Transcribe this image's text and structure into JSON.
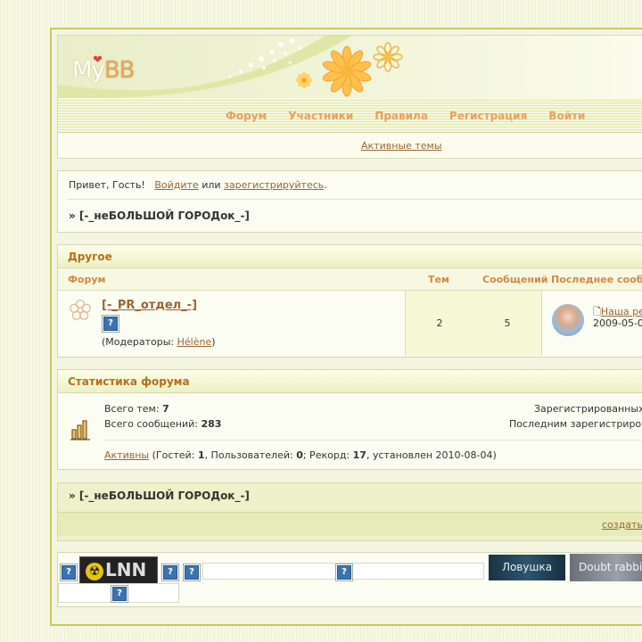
{
  "header": {
    "logo_my": "My",
    "logo_bb": "BB",
    "nav": [
      "Форум",
      "Участники",
      "Правила",
      "Регистрация",
      "Войти"
    ],
    "subnav_link": "Активные темы"
  },
  "welcome": {
    "greeting": "Привет, Гость!",
    "login_link": "Войдите",
    "or_text": "или",
    "register_link": "зарегистрируйтесь",
    "period": ".",
    "breadcrumb": "» [-_неБОЛЬШОЙ ГОРОДок_-]"
  },
  "forum": {
    "category": "Другое",
    "columns": {
      "forum": "Форум",
      "topics": "Тем",
      "posts": "Сообщений",
      "last": "Последнее сооб"
    },
    "rows": [
      {
        "name": "[-_PR_отдел_-]",
        "moderators_prefix": "(Модераторы:",
        "moderator": "Hélène",
        "moderators_suffix": ")",
        "topics": "2",
        "posts": "5",
        "last_post_title": "Наша ре",
        "last_post_date": "2009-05-0"
      }
    ]
  },
  "stats": {
    "title": "Статистика форума",
    "topics_label": "Всего тем:",
    "topics_value": "7",
    "posts_label": "Всего сообщений:",
    "posts_value": "283",
    "registered_label": "Зарегистрированных",
    "last_registered_label": "Последним зарегистриров",
    "active_link": "Активны",
    "active_text_1": " (Гостей: ",
    "guests": "1",
    "active_text_2": ", Пользователей: ",
    "users": "0",
    "active_text_3": "; Рекорд: ",
    "record": "17",
    "active_text_4": ", установлен 2010-08-04)"
  },
  "bottom": {
    "breadcrumb": "» [-_неБОЛЬШОЙ ГОРОДок_-]",
    "create_link": "создать"
  },
  "buttons": {
    "lnn": "LNN",
    "lovushka": "Ловушка",
    "rabbit": "Doubt rabbit",
    "unknown_icon": "?"
  },
  "colors": {
    "accent": "#b46f1a",
    "nav": "#e8a05f",
    "link": "#996633",
    "frame_border": "#c8c860"
  }
}
